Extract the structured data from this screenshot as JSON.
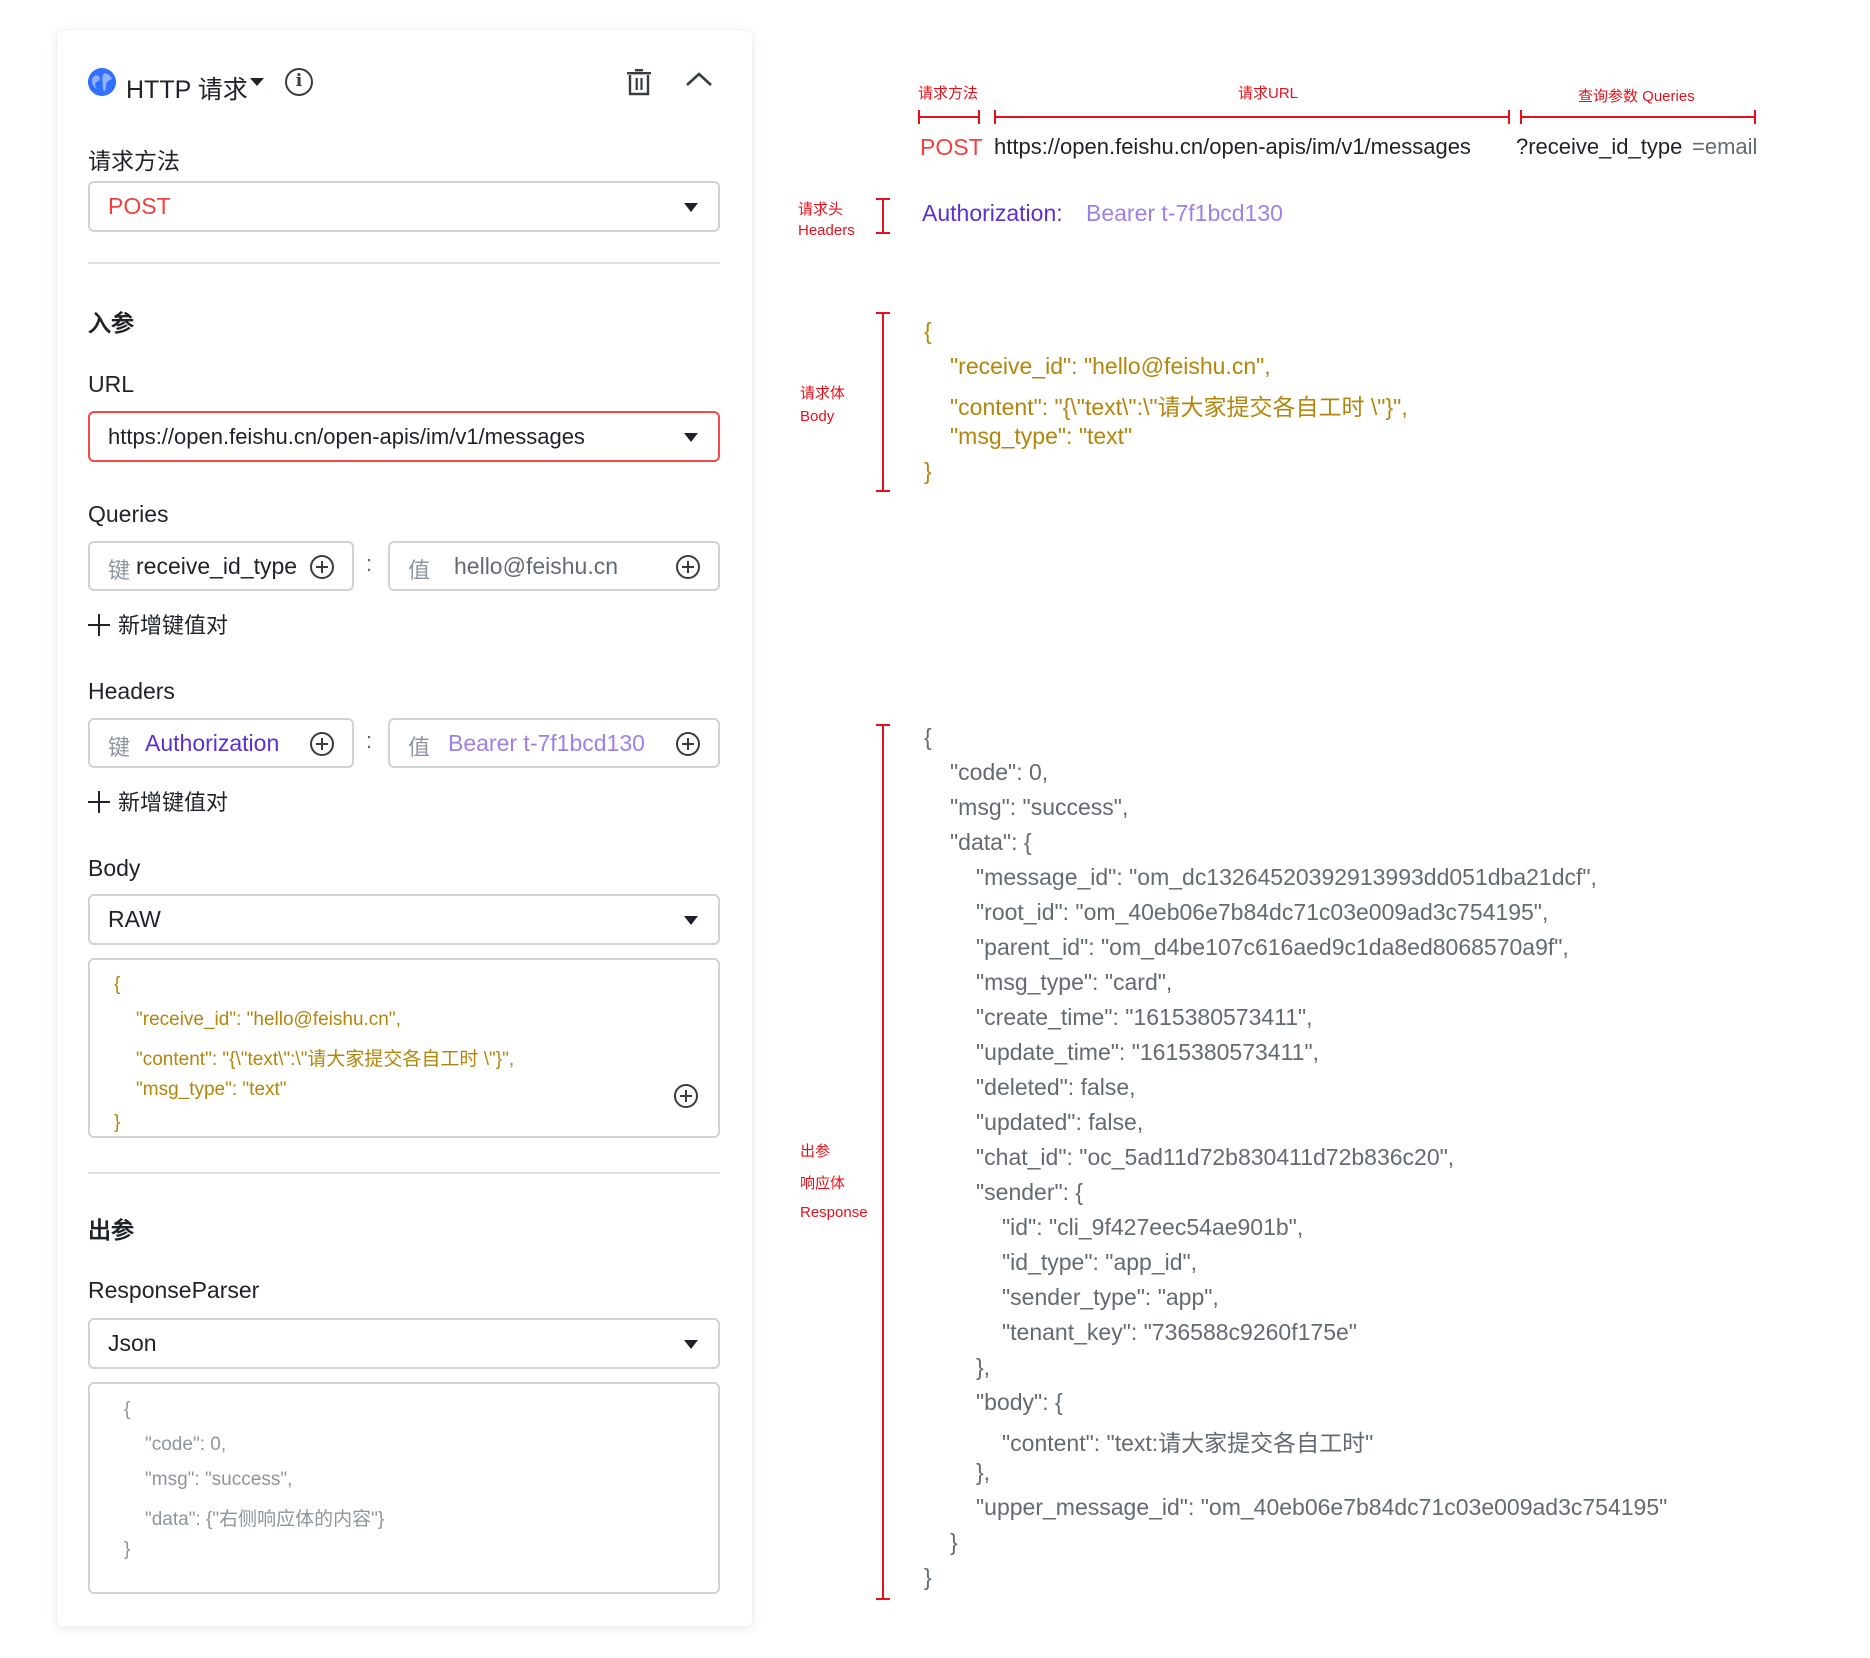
{
  "panel": {
    "title": "HTTP 请求",
    "info_symbol": "i",
    "method_section_label": "请求方法",
    "method_value": "POST",
    "input_section_label": "入参",
    "url_label": "URL",
    "url_value": "https://open.feishu.cn/open-apis/im/v1/messages",
    "queries_label": "Queries",
    "key_prefix": "键",
    "value_prefix": "值",
    "colon": ":",
    "query_key": "receive_id_type",
    "query_value": "hello@feishu.cn",
    "add_pair_label": "新增键值对",
    "headers_label": "Headers",
    "header_key": "Authorization",
    "header_value": "Bearer t-7f1bcd130",
    "body_label": "Body",
    "body_type": "RAW",
    "body_lines": [
      "{",
      "\"receive_id\": \"hello@feishu.cn\",",
      "\"content\": \"{\\\"text\\\":\\\"请大家提交各自工时 \\\"}\",",
      "\"msg_type\": \"text\"",
      "}"
    ],
    "output_section_label": "出参",
    "parser_label": "ResponseParser",
    "parser_value": "Json",
    "response_lines": [
      "{",
      "\"code\": 0,",
      "\"msg\": \"success\",",
      "\"data\": {\"右侧响应体的内容\"}",
      "}"
    ]
  },
  "annotations": {
    "method_label": "请求方法",
    "url_label": "请求URL",
    "query_label": "查询参数 Queries",
    "method": "POST",
    "url": "https://open.feishu.cn/open-apis/im/v1/messages",
    "query_key_part": "?receive_id_type",
    "query_value_part": "=email",
    "headers_label_cn": "请求头",
    "headers_label_en": "Headers",
    "auth_key": "Authorization:",
    "auth_value": "Bearer t-7f1bcd130",
    "body_label_cn": "请求体",
    "body_label_en": "Body",
    "body_lines": [
      "{",
      "\"receive_id\": \"hello@feishu.cn\",",
      "\"content\": \"{\\\"text\\\":\\\"请大家提交各自工时 \\\"}\",",
      "\"msg_type\": \"text\"",
      "}"
    ],
    "response_label_1": "出参",
    "response_label_2": "响应体",
    "response_label_3": "Response",
    "response_lines": [
      "{",
      "\"code\": 0,",
      "\"msg\": \"success\",",
      "\"data\": {",
      "\"message_id\": \"om_dc13264520392913993dd051dba21dcf\",",
      "\"root_id\": \"om_40eb06e7b84dc71c03e009ad3c754195\",",
      "\"parent_id\": \"om_d4be107c616aed9c1da8ed8068570a9f\",",
      "\"msg_type\": \"card\",",
      "\"create_time\": \"1615380573411\",",
      "\"update_time\": \"1615380573411\",",
      "\"deleted\": false,",
      "\"updated\": false,",
      "\"chat_id\": \"oc_5ad11d72b830411d72b836c20\",",
      "\"sender\": {",
      "\"id\": \"cli_9f427eec54ae901b\",",
      "\"id_type\": \"app_id\",",
      "\"sender_type\": \"app\",",
      "\"tenant_key\": \"736588c9260f175e\"",
      "},",
      "\"body\": {",
      "\"content\": \"text:请大家提交各自工时\"",
      "},",
      "\"upper_message_id\": \"om_40eb06e7b84dc71c03e009ad3c754195\"",
      "}",
      "}"
    ]
  },
  "colors": {
    "method_red": "#f53f3f",
    "annotation_red": "#e8101b",
    "json_gold": "#b3860b",
    "header_key_purple": "#5b2fd6",
    "header_value_purple": "#9f7fe8",
    "accent_blue": "#3370ff"
  },
  "icons": [
    "globe-icon",
    "chevron-down-icon",
    "info-icon",
    "trash-icon",
    "chevron-up-icon",
    "plus-circle-icon",
    "plus-icon"
  ]
}
